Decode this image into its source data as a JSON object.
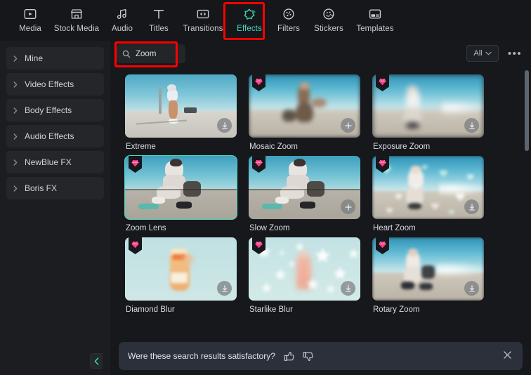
{
  "topbar": {
    "tabs": [
      {
        "label": "Media",
        "icon": "media-icon",
        "active": false
      },
      {
        "label": "Stock Media",
        "icon": "stock-media-icon",
        "active": false
      },
      {
        "label": "Audio",
        "icon": "audio-icon",
        "active": false
      },
      {
        "label": "Titles",
        "icon": "titles-icon",
        "active": false
      },
      {
        "label": "Transitions",
        "icon": "transitions-icon",
        "active": false
      },
      {
        "label": "Effects",
        "icon": "effects-icon",
        "active": true
      },
      {
        "label": "Filters",
        "icon": "filters-icon",
        "active": false
      },
      {
        "label": "Stickers",
        "icon": "stickers-icon",
        "active": false
      },
      {
        "label": "Templates",
        "icon": "templates-icon",
        "active": false
      }
    ]
  },
  "sidebar": {
    "items": [
      {
        "label": "Mine"
      },
      {
        "label": "Video Effects"
      },
      {
        "label": "Body Effects"
      },
      {
        "label": "Audio Effects"
      },
      {
        "label": "NewBlue FX"
      },
      {
        "label": "Boris FX"
      }
    ],
    "collapse_icon": "chevron-left-icon"
  },
  "search": {
    "value": "Zoom",
    "placeholder": "Search",
    "icon": "search-icon"
  },
  "filter": {
    "selected": "All",
    "icon": "chevron-down-icon",
    "more_label": "•••"
  },
  "results": {
    "items": [
      {
        "title": "Extreme",
        "pro": false,
        "selected": false,
        "action": "download-icon"
      },
      {
        "title": "Mosaic Zoom",
        "pro": true,
        "selected": false,
        "action": "add-icon"
      },
      {
        "title": "Exposure Zoom",
        "pro": true,
        "selected": false,
        "action": "download-icon"
      },
      {
        "title": "Zoom Lens",
        "pro": true,
        "selected": true,
        "action": "none"
      },
      {
        "title": "Slow Zoom",
        "pro": true,
        "selected": false,
        "action": "add-icon"
      },
      {
        "title": "Heart Zoom",
        "pro": true,
        "selected": false,
        "action": "download-icon"
      },
      {
        "title": "Diamond Blur",
        "pro": true,
        "selected": false,
        "action": "download-icon"
      },
      {
        "title": "Starlike Blur",
        "pro": true,
        "selected": false,
        "action": "download-icon"
      },
      {
        "title": "Rotary Zoom",
        "pro": true,
        "selected": false,
        "action": "download-icon"
      }
    ]
  },
  "feedback": {
    "question": "Were these search results satisfactory?",
    "thumbs_up_icon": "thumbs-up-icon",
    "thumbs_down_icon": "thumbs-down-icon",
    "close_icon": "close-icon"
  },
  "colors": {
    "accent": "#43dbc0",
    "annotation": "#ff0000",
    "pro_badge": "#ff3d8b",
    "sidebar_bg": "#1b1d21",
    "content_bg": "#16181c",
    "feedback_bg": "#2b303a"
  },
  "annotations": [
    {
      "target": "effects-tab"
    },
    {
      "target": "search-input"
    }
  ]
}
